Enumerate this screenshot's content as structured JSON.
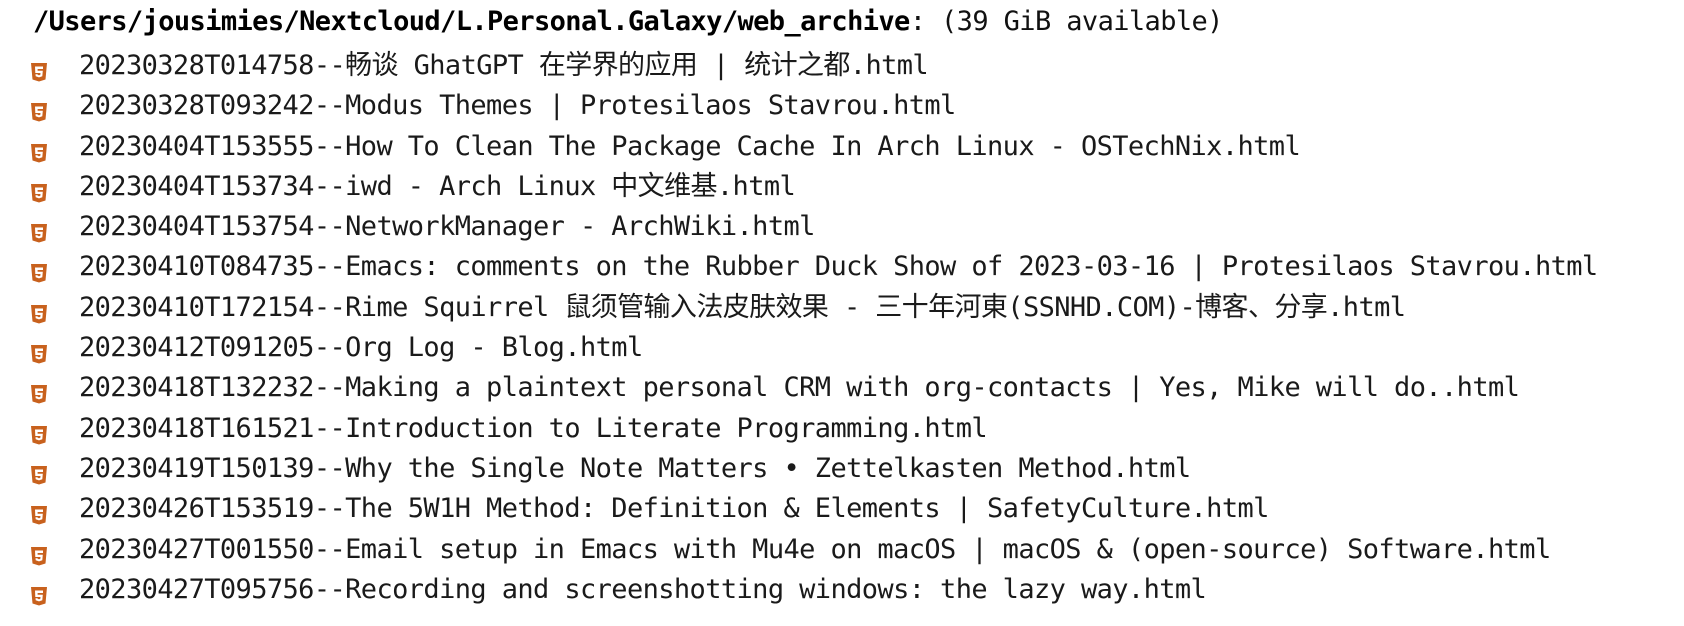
{
  "header": {
    "path": "/Users/jousimies/Nextcloud/L.Personal.Galaxy/web_archive",
    "available": ": (39 GiB available)"
  },
  "file_icon": {
    "name": "html5-file-icon",
    "color": "#c8611d"
  },
  "files": [
    "20230328T014758--畅谈 GhatGPT 在学界的应用 | 统计之都.html",
    "20230328T093242--Modus Themes | Protesilaos Stavrou.html",
    "20230404T153555--How To Clean The Package Cache In Arch Linux - OSTechNix.html",
    "20230404T153734--iwd - Arch Linux 中文维基.html",
    "20230404T153754--NetworkManager - ArchWiki.html",
    "20230410T084735--Emacs: comments on the Rubber Duck Show of 2023-03-16 | Protesilaos Stavrou.html",
    "20230410T172154--Rime Squirrel 鼠须管输入法皮肤效果 - 三十年河東(SSNHD.COM)-博客、分享.html",
    "20230412T091205--Org Log - Blog.html",
    "20230418T132232--Making a plaintext personal CRM with org-contacts | Yes, Mike will do..html",
    "20230418T161521--Introduction to Literate Programming.html",
    "20230419T150139--Why the Single Note Matters • Zettelkasten Method.html",
    "20230426T153519--The 5W1H Method: Definition & Elements | SafetyCulture.html",
    "20230427T001550--Email setup in Emacs with Mu4e on macOS | macOS & (open-source) Software.html",
    "20230427T095756--Recording and screenshotting windows: the lazy way.html"
  ]
}
